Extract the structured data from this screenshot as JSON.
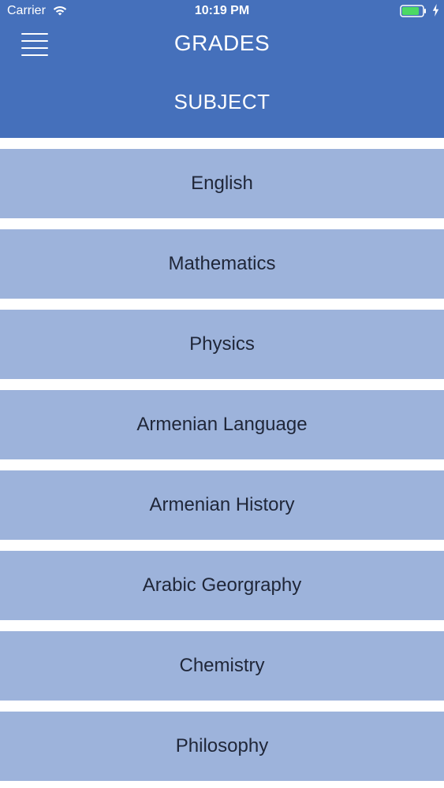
{
  "status_bar": {
    "carrier": "Carrier",
    "time": "10:19 PM",
    "icons": {
      "wifi": "wifi-icon",
      "battery": "battery-icon",
      "charging": "charging-icon"
    }
  },
  "header": {
    "menu_icon": "hamburger-menu-icon",
    "title": "GRADES",
    "subtitle": "SUBJECT"
  },
  "subjects": [
    {
      "label": "English"
    },
    {
      "label": "Mathematics"
    },
    {
      "label": "Physics"
    },
    {
      "label": "Armenian Language"
    },
    {
      "label": "Armenian History"
    },
    {
      "label": "Arabic Georgraphy"
    },
    {
      "label": "Chemistry"
    },
    {
      "label": "Philosophy"
    }
  ],
  "colors": {
    "header_background": "#4570bb",
    "subject_background": "#9db3db",
    "subject_text": "#1f2638",
    "battery_fill": "#4cd964"
  }
}
